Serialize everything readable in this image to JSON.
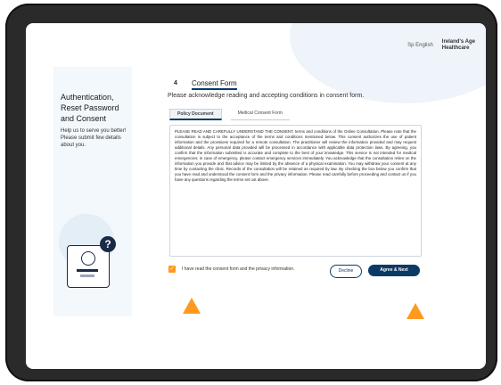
{
  "header": {
    "language_link": "Sp English",
    "brand_line1": "Ireland's Age",
    "brand_line2": "Healthcare"
  },
  "left_panel": {
    "title": "Authentication, Reset Password and Consent",
    "subtitle": "Help us to serve you better! Please submit few details about you."
  },
  "step": {
    "number": "4",
    "title": "Consent Form",
    "description": "Please acknowledge reading and accepting conditions in consent form."
  },
  "tabs": [
    {
      "label": "Policy Document"
    },
    {
      "label": "Medical Consent Form"
    }
  ],
  "consent_text": "PLEASE READ AND CAREFULLY UNDERSTAND THE CONSENT, terms and conditions of the Online Consultation. Please note that the consultation is subject to the acceptance of the terms and conditions mentioned below. This consent authorizes the use of patient information and the provisions required for a remote consultation. The practitioner will review the information provided and may request additional details. Any personal data provided will be processed in accordance with applicable data protection laws. By agreeing, you confirm that the information submitted is accurate and complete to the best of your knowledge. This service is not intended for medical emergencies; in case of emergency, please contact emergency services immediately. You acknowledge that the consultation relies on the information you provide and that advice may be limited by the absence of a physical examination. You may withdraw your consent at any time by contacting the clinic. Records of the consultation will be retained as required by law. By checking the box below you confirm that you have read and understood the consent form and the privacy information. Please read carefully before proceeding and contact us if you have any questions regarding the terms set out above.",
  "footer": {
    "checkbox_label": "I have read the consent form and the privacy information.",
    "decline_label": "Decline",
    "agree_label": "Agree & Next"
  },
  "colors": {
    "accent": "#0b3a66",
    "highlight": "#ff9a1f"
  }
}
